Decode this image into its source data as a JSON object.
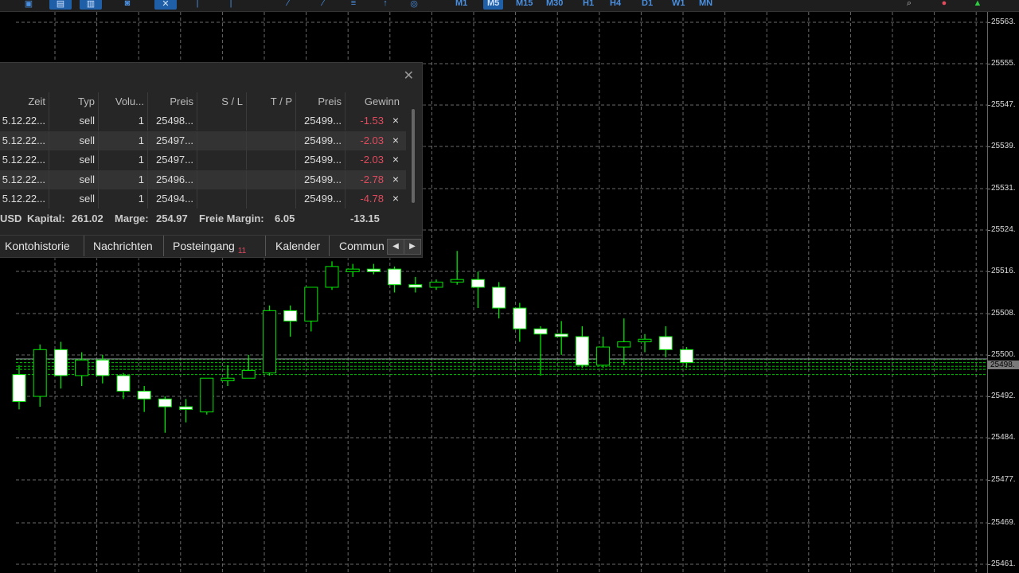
{
  "toolbar": {
    "timeframes": [
      {
        "label": "M1",
        "active": false
      },
      {
        "label": "M5",
        "active": true
      },
      {
        "label": "M15",
        "active": false
      },
      {
        "label": "M30",
        "active": false
      },
      {
        "label": "H1",
        "active": false
      },
      {
        "label": "H4",
        "active": false
      },
      {
        "label": "D1",
        "active": false
      },
      {
        "label": "W1",
        "active": false
      },
      {
        "label": "MN",
        "active": false
      }
    ]
  },
  "price_axis": {
    "labels": [
      "25563.",
      "25555.",
      "25547.",
      "25539.",
      "25531.",
      "25524.",
      "25516.",
      "25508.",
      "25500.",
      "25492.",
      "25484.",
      "25477.",
      "25469.",
      "25461."
    ],
    "current_price": "25498."
  },
  "colors": {
    "bull_body": "#000000",
    "bear_body": "#ffffff",
    "wick": "#00e600",
    "grid": "#6a6a6a",
    "order_lines": "#00c800",
    "bid_line": "#9aa0a6",
    "loss": "#e04b5e"
  },
  "chart_data": {
    "type": "candlestick",
    "candles": [
      {
        "o": 25496.2,
        "h": 25498.0,
        "l": 25489.5,
        "c": 25491.0
      },
      {
        "o": 25492.0,
        "h": 25502.0,
        "l": 25490.0,
        "c": 25501.0
      },
      {
        "o": 25501.0,
        "h": 25502.5,
        "l": 25493.5,
        "c": 25496.0
      },
      {
        "o": 25496.0,
        "h": 25500.5,
        "l": 25494.0,
        "c": 25499.0
      },
      {
        "o": 25499.0,
        "h": 25500.0,
        "l": 25494.5,
        "c": 25496.0
      },
      {
        "o": 25496.0,
        "h": 25496.5,
        "l": 25491.5,
        "c": 25493.0
      },
      {
        "o": 25493.0,
        "h": 25494.0,
        "l": 25489.0,
        "c": 25491.5
      },
      {
        "o": 25491.5,
        "h": 25492.0,
        "l": 25485.0,
        "c": 25490.0
      },
      {
        "o": 25490.0,
        "h": 25491.5,
        "l": 25487.0,
        "c": 25489.5
      },
      {
        "o": 25489.0,
        "h": 25495.5,
        "l": 25488.5,
        "c": 25495.5
      },
      {
        "o": 25495.0,
        "h": 25498.0,
        "l": 25494.0,
        "c": 25495.5
      },
      {
        "o": 25495.5,
        "h": 25500.0,
        "l": 25495.5,
        "c": 25497.0
      },
      {
        "o": 25496.5,
        "h": 25509.5,
        "l": 25496.0,
        "c": 25508.5
      },
      {
        "o": 25508.5,
        "h": 25509.5,
        "l": 25503.5,
        "c": 25506.5
      },
      {
        "o": 25506.5,
        "h": 25513.0,
        "l": 25504.5,
        "c": 25513.0
      },
      {
        "o": 25513.0,
        "h": 25518.0,
        "l": 25512.5,
        "c": 25517.0
      },
      {
        "o": 25516.0,
        "h": 25517.5,
        "l": 25515.0,
        "c": 25516.5
      },
      {
        "o": 25516.5,
        "h": 25517.5,
        "l": 25515.5,
        "c": 25516.0
      },
      {
        "o": 25516.5,
        "h": 25517.0,
        "l": 25512.0,
        "c": 25513.5
      },
      {
        "o": 25513.5,
        "h": 25515.0,
        "l": 25512.0,
        "c": 25513.0
      },
      {
        "o": 25513.0,
        "h": 25514.5,
        "l": 25512.5,
        "c": 25514.0
      },
      {
        "o": 25514.0,
        "h": 25520.0,
        "l": 25513.5,
        "c": 25514.5
      },
      {
        "o": 25514.5,
        "h": 25516.0,
        "l": 25509.0,
        "c": 25513.0
      },
      {
        "o": 25513.0,
        "h": 25514.0,
        "l": 25507.0,
        "c": 25509.0
      },
      {
        "o": 25509.0,
        "h": 25510.0,
        "l": 25502.5,
        "c": 25505.0
      },
      {
        "o": 25505.0,
        "h": 25505.5,
        "l": 25496.0,
        "c": 25504.0
      },
      {
        "o": 25504.0,
        "h": 25506.5,
        "l": 25500.0,
        "c": 25503.5
      },
      {
        "o": 25503.5,
        "h": 25505.5,
        "l": 25497.5,
        "c": 25498.0
      },
      {
        "o": 25498.0,
        "h": 25503.5,
        "l": 25497.5,
        "c": 25501.5
      },
      {
        "o": 25501.5,
        "h": 25507.0,
        "l": 25498.0,
        "c": 25502.5
      },
      {
        "o": 25502.5,
        "h": 25504.0,
        "l": 25500.5,
        "c": 25503.0
      },
      {
        "o": 25503.5,
        "h": 25505.5,
        "l": 25499.5,
        "c": 25501.0
      },
      {
        "o": 25501.0,
        "h": 25501.5,
        "l": 25497.5,
        "c": 25498.5
      }
    ],
    "order_levels": [
      25499.15,
      25498.5,
      25497.8,
      25497.2,
      25496.2
    ],
    "bid_line": 25499.2,
    "ylim": [
      25458.0,
      25566.0
    ],
    "grid": true
  },
  "positions_panel": {
    "columns": [
      "Zeit",
      "Typ",
      "Volu...",
      "Preis",
      "S / L",
      "T / P",
      "Preis",
      "Gewinn"
    ],
    "rows": [
      {
        "time": "5.12.22...",
        "type": "sell",
        "volume": "1",
        "open_price": "25498...",
        "sl": "",
        "tp": "",
        "price": "25499...",
        "profit": "-1.53"
      },
      {
        "time": "5.12.22...",
        "type": "sell",
        "volume": "1",
        "open_price": "25497...",
        "sl": "",
        "tp": "",
        "price": "25499...",
        "profit": "-2.03"
      },
      {
        "time": "5.12.22...",
        "type": "sell",
        "volume": "1",
        "open_price": "25497...",
        "sl": "",
        "tp": "",
        "price": "25499...",
        "profit": "-2.03"
      },
      {
        "time": "5.12.22...",
        "type": "sell",
        "volume": "1",
        "open_price": "25496...",
        "sl": "",
        "tp": "",
        "price": "25499...",
        "profit": "-2.78"
      },
      {
        "time": "5.12.22...",
        "type": "sell",
        "volume": "1",
        "open_price": "25494...",
        "sl": "",
        "tp": "",
        "price": "25499...",
        "profit": "-4.78"
      }
    ],
    "close_symbol": "×",
    "summary": {
      "currency": "USD",
      "capital_label": "Kapital:",
      "capital": "261.02",
      "margin_label": "Marge:",
      "margin": "254.97",
      "free_margin_label": "Freie Margin:",
      "free_margin": "6.05",
      "total": "-13.15"
    },
    "tabs": [
      {
        "label": "Kontohistorie"
      },
      {
        "label": "Nachrichten"
      },
      {
        "label": "Posteingang",
        "badge": "11"
      },
      {
        "label": "Kalender"
      },
      {
        "label": "Commun"
      }
    ]
  }
}
